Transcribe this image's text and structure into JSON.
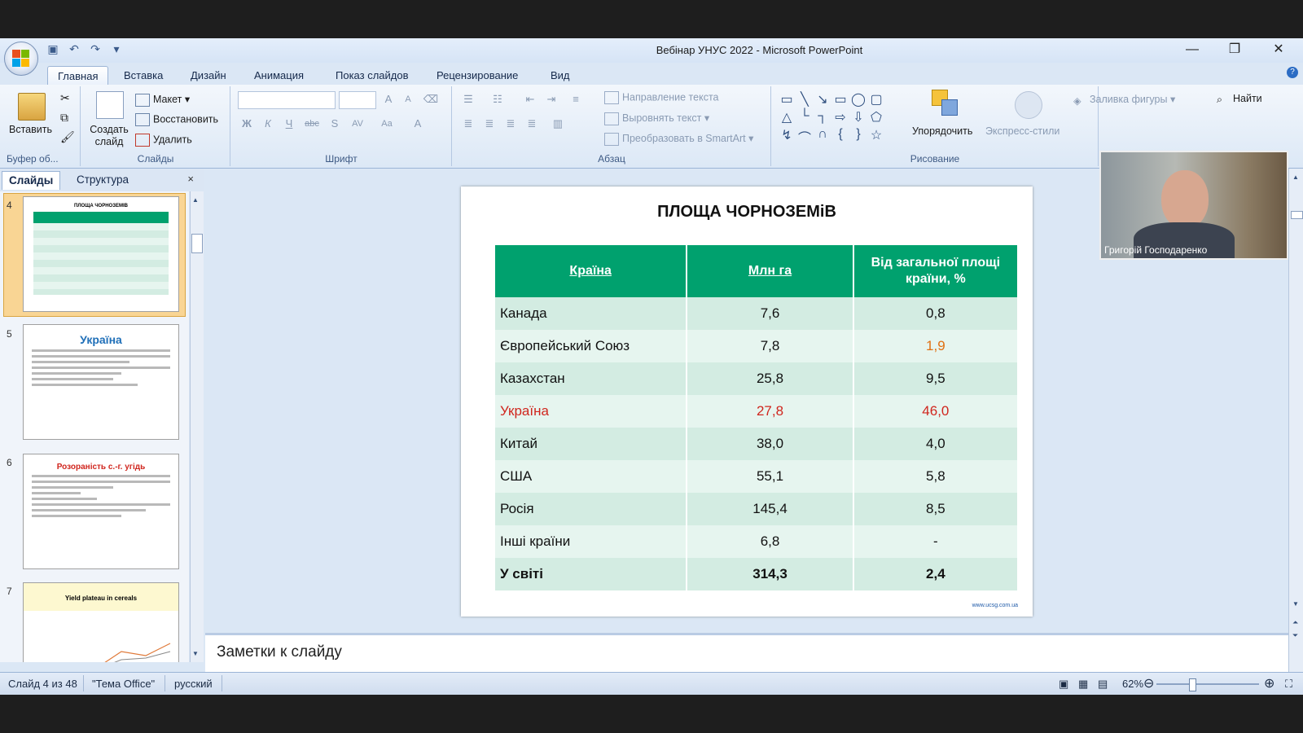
{
  "window": {
    "title": "Вебінар УНУС 2022 - Microsoft PowerPoint",
    "minimize": "—",
    "restore": "❐",
    "close": "✕"
  },
  "ribbon_tabs": [
    "Главная",
    "Вставка",
    "Дизайн",
    "Анимация",
    "Показ слайдов",
    "Рецензирование",
    "Вид"
  ],
  "ribbon": {
    "clipboard": {
      "paste": "Вставить",
      "label": "Буфер об..."
    },
    "slides": {
      "new_slide": "Создать слайд",
      "layout": "Макет",
      "reset": "Восстановить",
      "delete": "Удалить",
      "label": "Слайды"
    },
    "font": {
      "label": "Шрифт"
    },
    "paragraph": {
      "text_direction": "Направление текста",
      "align_text": "Выровнять текст",
      "smartart": "Преобразовать в SmartArt",
      "label": "Абзац"
    },
    "drawing": {
      "arrange": "Упорядочить",
      "quick_styles": "Экспресс-стили",
      "shape_fill": "Заливка фигуры",
      "label": "Рисование"
    },
    "editing": {
      "find": "Найти"
    }
  },
  "left_pane": {
    "tab_slides": "Слайды",
    "tab_outline": "Структура",
    "close": "×",
    "thumbnails": [
      {
        "number": "4",
        "title": "ПЛОЩА ЧОРНОЗЕМІВ"
      },
      {
        "number": "5",
        "title": "Україна"
      },
      {
        "number": "6",
        "title": "Розораність с.-г. угідь"
      },
      {
        "number": "7",
        "title": "Yield plateau in cereals"
      }
    ]
  },
  "slide": {
    "title": "ПЛОЩА ЧОРНОЗЕМіВ",
    "headers": [
      "Країна",
      "Млн га",
      "Від загальної площі країни, %"
    ],
    "rows": [
      [
        "Канада",
        "7,6",
        "0,8"
      ],
      [
        "Європейський Союз",
        "7,8",
        "1,9"
      ],
      [
        "Казахстан",
        "25,8",
        "9,5"
      ],
      [
        "Україна",
        "27,8",
        "46,0"
      ],
      [
        "Китай",
        "38,0",
        "4,0"
      ],
      [
        "США",
        "55,1",
        "5,8"
      ],
      [
        "Росія",
        "145,4",
        "8,5"
      ],
      [
        "Інші країни",
        "6,8",
        "-"
      ],
      [
        "У світі",
        "314,3",
        "2,4"
      ]
    ],
    "footer": "www.ucsg.com.ua"
  },
  "notes": {
    "placeholder": "Заметки к слайду"
  },
  "video": {
    "participant": "Григорій Господаренко"
  },
  "status": {
    "slide_count": "Слайд 4 из 48",
    "theme": "\"Тема Office\"",
    "language": "русский",
    "zoom": "62%"
  }
}
